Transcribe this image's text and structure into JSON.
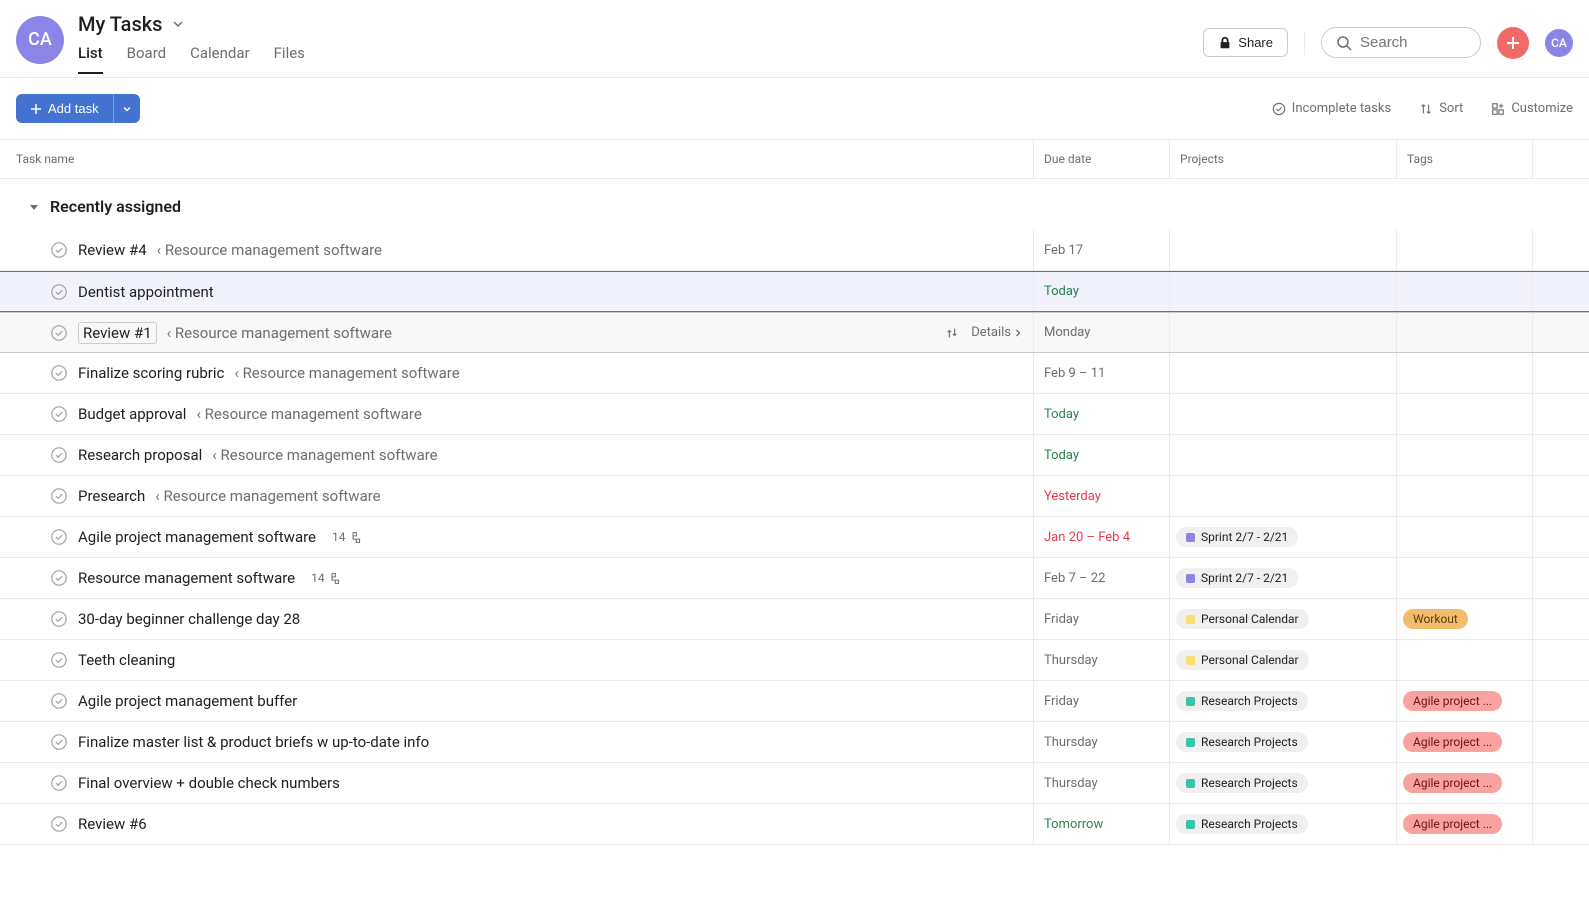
{
  "user_initials": "CA",
  "page_title": "My Tasks",
  "tabs": [
    "List",
    "Board",
    "Calendar",
    "Files"
  ],
  "active_tab": 0,
  "share_label": "Share",
  "search_placeholder": "Search",
  "add_task_label": "Add task",
  "toolbar": {
    "incomplete": "Incomplete tasks",
    "sort": "Sort",
    "customize": "Customize"
  },
  "columns": {
    "name": "Task name",
    "due": "Due date",
    "projects": "Projects",
    "tags": "Tags"
  },
  "section_title": "Recently assigned",
  "details_label": "Details",
  "project_pills": {
    "sprint": {
      "label": "Sprint 2/7 - 2/21",
      "color": "#8d84e8"
    },
    "personal": {
      "label": "Personal Calendar",
      "color": "#f8df72"
    },
    "research": {
      "label": "Research Projects",
      "color": "#37c5ab"
    }
  },
  "tag_pills": {
    "workout": {
      "label": "Workout",
      "bg": "#f1bd6c",
      "fg": "#5a3b06"
    },
    "agile": {
      "label": "Agile project ...",
      "bg": "#f8a3a0",
      "fg": "#6d1412"
    }
  },
  "tasks": [
    {
      "name": "Review #4",
      "parent": "Resource management software",
      "due": "Feb 17",
      "due_class": ""
    },
    {
      "name": "Dentist appointment",
      "due": "Today",
      "due_class": "green",
      "selected": true
    },
    {
      "name": "Review #1",
      "parent": "Resource management software",
      "due": "Monday",
      "due_class": "",
      "hover": true,
      "boxed": true
    },
    {
      "name": "Finalize scoring rubric",
      "parent": "Resource management software",
      "due": "Feb 9 – 11",
      "due_class": ""
    },
    {
      "name": "Budget approval",
      "parent": "Resource management software",
      "due": "Today",
      "due_class": "green"
    },
    {
      "name": "Research proposal",
      "parent": "Resource management software",
      "due": "Today",
      "due_class": "green"
    },
    {
      "name": "Presearch",
      "parent": "Resource management software",
      "due": "Yesterday",
      "due_class": "red"
    },
    {
      "name": "Agile project management software",
      "subtasks": "14",
      "due": "Jan 20 – Feb 4",
      "due_class": "red",
      "project": "sprint"
    },
    {
      "name": "Resource management software",
      "subtasks": "14",
      "due": "Feb 7 – 22",
      "due_class": "",
      "project": "sprint"
    },
    {
      "name": "30-day beginner challenge day 28",
      "due": "Friday",
      "due_class": "",
      "project": "personal",
      "tag": "workout"
    },
    {
      "name": "Teeth cleaning",
      "due": "Thursday",
      "due_class": "",
      "project": "personal"
    },
    {
      "name": "Agile project management buffer",
      "due": "Friday",
      "due_class": "",
      "project": "research",
      "tag": "agile"
    },
    {
      "name": "Finalize master list & product briefs w up-to-date info",
      "due": "Thursday",
      "due_class": "",
      "project": "research",
      "tag": "agile"
    },
    {
      "name": "Final overview + double check numbers",
      "due": "Thursday",
      "due_class": "",
      "project": "research",
      "tag": "agile"
    },
    {
      "name": "Review #6",
      "due": "Tomorrow",
      "due_class": "green",
      "project": "research",
      "tag": "agile",
      "cut": true
    }
  ]
}
